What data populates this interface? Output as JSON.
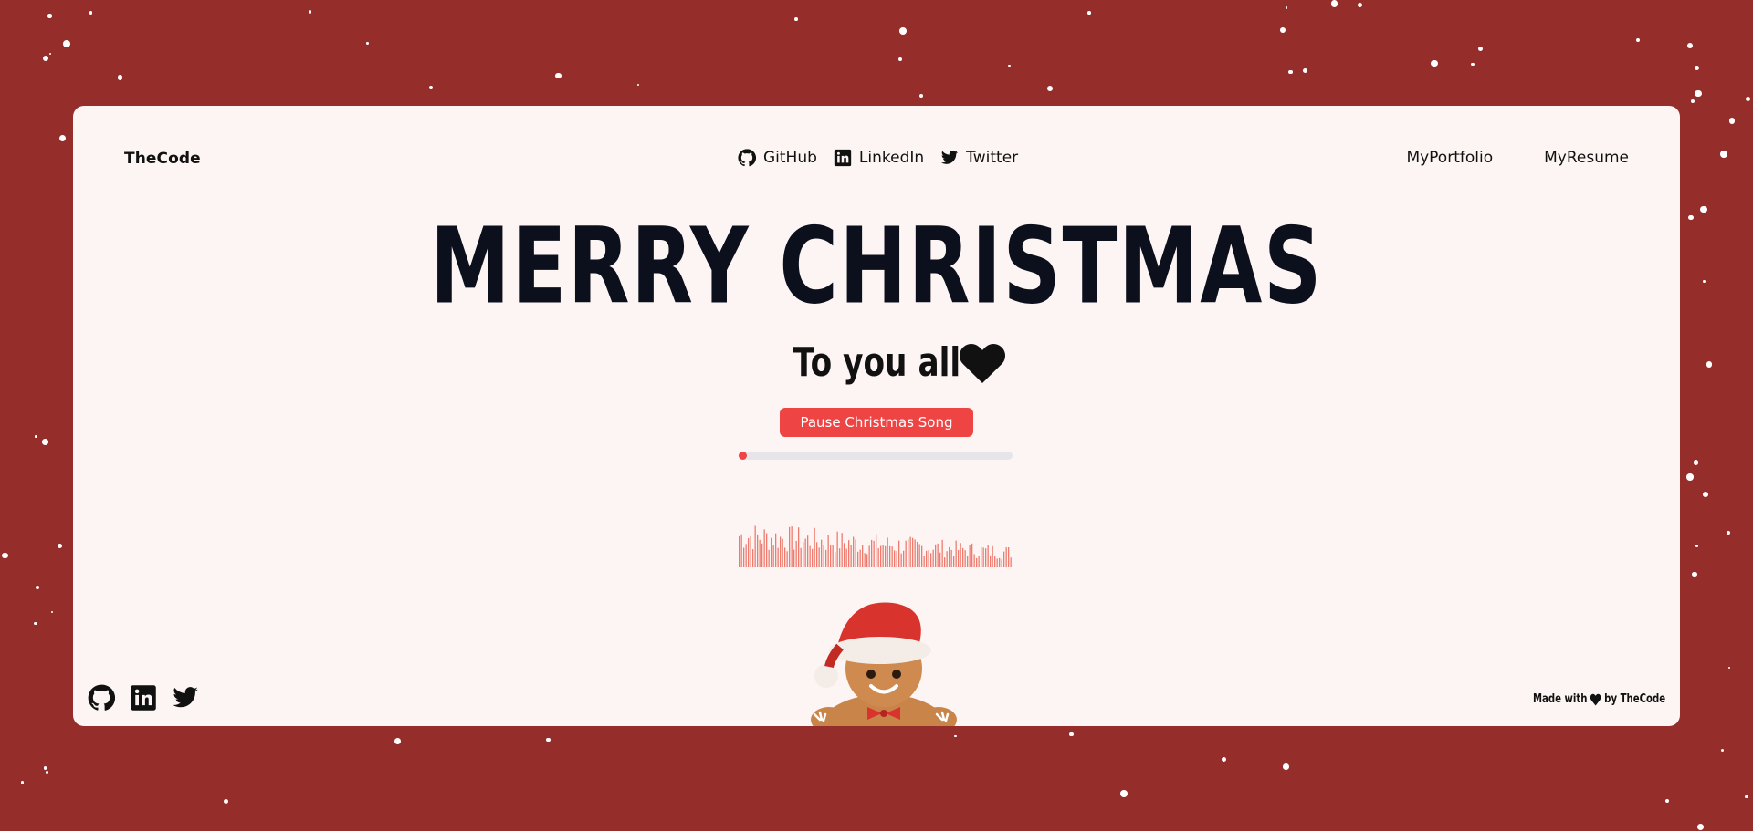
{
  "brand": "TheCode",
  "social_nav": [
    {
      "label": "GitHub",
      "icon": "github-icon"
    },
    {
      "label": "LinkedIn",
      "icon": "linkedin-icon"
    },
    {
      "label": "Twitter",
      "icon": "twitter-icon"
    }
  ],
  "right_nav": [
    {
      "label": "MyPortfolio"
    },
    {
      "label": "MyResume"
    }
  ],
  "headline": "MERRY CHRISTMAS",
  "subline": "To you all",
  "player": {
    "button_label": "Pause Christmas Song",
    "progress_fraction": 0.01
  },
  "footer": {
    "made_with": "Made with",
    "by": "by TheCode",
    "icons": [
      "github-icon",
      "linkedin-icon",
      "twitter-icon"
    ]
  },
  "colors": {
    "background": "#952d2a",
    "card": "#fcf5f3",
    "accent": "#ef4444",
    "text": "#0c0f1c"
  }
}
